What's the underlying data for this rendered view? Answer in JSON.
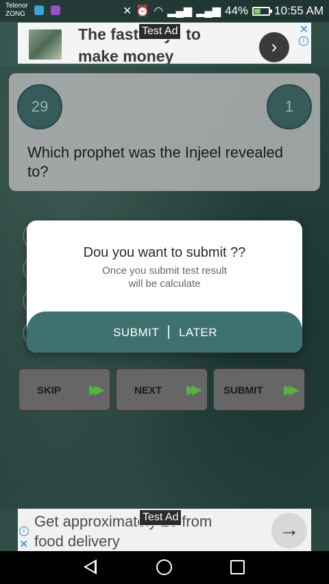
{
  "status_bar": {
    "carrier_line1": "Telenor",
    "carrier_line2": "ZONG",
    "battery_percent": "44%",
    "battery_level": 0.44,
    "time": "10:55 AM",
    "icons": [
      "mute-icon",
      "alarm-icon",
      "wifi-icon",
      "signal-icon",
      "signal-icon",
      "battery-icon"
    ]
  },
  "ad_top": {
    "label": "Test Ad",
    "text_line1": "The fast ways to",
    "text_line2": "make money",
    "go_glyph": "›",
    "close_glyph": "✕",
    "info_glyph": "i"
  },
  "question": {
    "count_left": "29",
    "count_right": "1",
    "text": "Which prophet was the Injeel revealed to?"
  },
  "actions": {
    "skip_label": "SKIP",
    "next_label": "NEXT",
    "submit_label": "SUBMIT",
    "arrow_glyph": "▶▶"
  },
  "dialog": {
    "title": "Dou you want to submit ??",
    "message_line1": "Once you submit test result",
    "message_line2": "will be calculate",
    "submit_label": "SUBMIT",
    "later_label": "LATER"
  },
  "ad_bottom": {
    "label": "Test Ad",
    "text_line1": "Get approximately 20 from",
    "text_line2": "food delivery",
    "go_glyph": "→",
    "close_glyph": "✕",
    "info_glyph": "i"
  },
  "colors": {
    "accent_teal": "#3f7171",
    "circle_teal": "#3a6362",
    "arrow_green": "#5fc24a",
    "battery_green": "#7dd35b"
  }
}
